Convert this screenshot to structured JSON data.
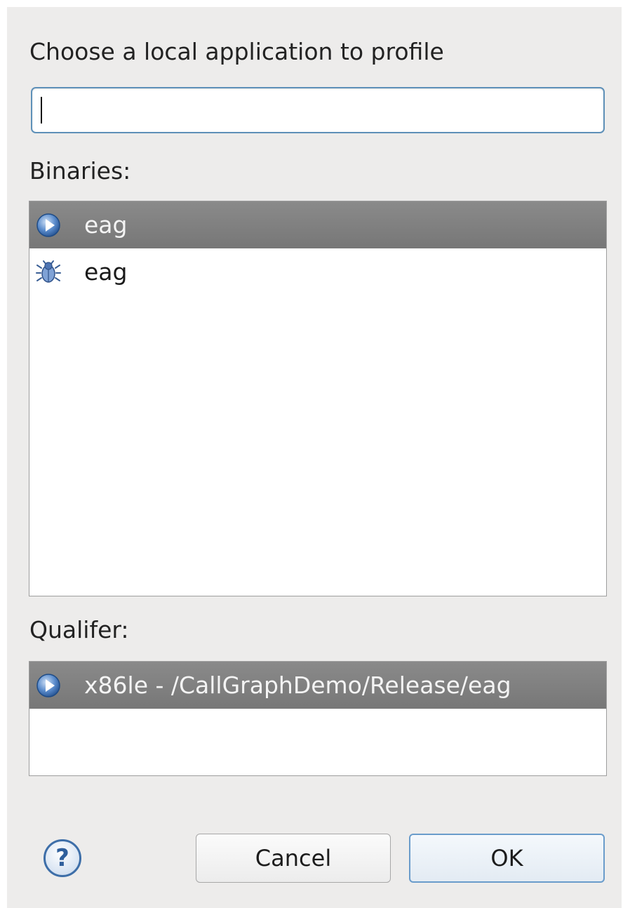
{
  "dialog": {
    "heading": "Choose a local application to profile",
    "filter": {
      "value": "",
      "placeholder": ""
    },
    "binaries_label": "Binaries:",
    "binaries": [
      {
        "label": "eag",
        "icon": "run-icon",
        "selected": true
      },
      {
        "label": "eag",
        "icon": "debug-bug-icon",
        "selected": false
      }
    ],
    "qualifier_label": "Qualifer:",
    "qualifiers": [
      {
        "label": "x86le - /CallGraphDemo/Release/eag",
        "icon": "run-icon",
        "selected": true
      }
    ],
    "buttons": {
      "help": "?",
      "cancel": "Cancel",
      "ok": "OK"
    }
  },
  "colors": {
    "dialog_bg": "#edeceb",
    "selection_bg": "#808080",
    "focus_border": "#5e90b8",
    "icon_blue": "#3d6ea8"
  }
}
